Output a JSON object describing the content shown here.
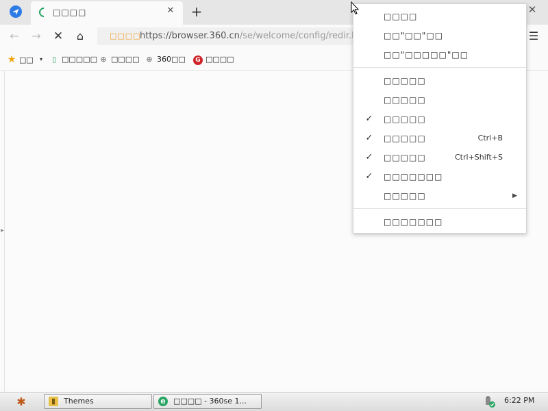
{
  "tabstrip": {
    "app_icon": "send-icon",
    "tab_title": "□□□□",
    "tab_close": "✕",
    "new_tab": "+",
    "window_close": "✕"
  },
  "toolbar": {
    "back": "←",
    "forward": "→",
    "stop": "✕",
    "home": "⌂",
    "address_tag": "□□□□",
    "url_host": "https://browser.360.cn",
    "url_path": "/se/welcome/config/redir.htm",
    "menu": "☰"
  },
  "bookmarks": [
    {
      "icon": "star-icon",
      "glyph": "★",
      "label": "□□"
    },
    {
      "icon": "phone-icon",
      "glyph": "▯",
      "label": "□□□□□"
    },
    {
      "icon": "globe-icon",
      "glyph": "⊕",
      "label": "□□□□"
    },
    {
      "icon": "globe-icon",
      "glyph": "⊕",
      "label": "360□□"
    },
    {
      "icon": "g-logo-icon",
      "glyph": "G",
      "label": "□□□□"
    }
  ],
  "bookmarks_dropdown": "▾",
  "context_menu": {
    "items": [
      {
        "label": "□□□□",
        "checked": false,
        "shortcut": "",
        "submenu": false
      },
      {
        "label": "□□\"□□\"□□",
        "checked": false,
        "shortcut": "",
        "submenu": false
      },
      {
        "label": "□□\"□□□□□\"□□",
        "checked": false,
        "shortcut": "",
        "submenu": false
      },
      {
        "label": "□□□□□",
        "checked": false,
        "shortcut": "",
        "submenu": false
      },
      {
        "label": "□□□□□",
        "checked": false,
        "shortcut": "",
        "submenu": false
      },
      {
        "label": "□□□□□",
        "checked": true,
        "shortcut": "",
        "submenu": false
      },
      {
        "label": "□□□□□",
        "checked": true,
        "shortcut": "Ctrl+B",
        "submenu": false
      },
      {
        "label": "□□□□□",
        "checked": true,
        "shortcut": "Ctrl+Shift+S",
        "submenu": false
      },
      {
        "label": "□□□□□□□",
        "checked": true,
        "shortcut": "",
        "submenu": false
      },
      {
        "label": "□□□□□",
        "checked": false,
        "shortcut": "",
        "submenu": true
      },
      {
        "label": "□□□□□□□",
        "checked": false,
        "shortcut": "",
        "submenu": false
      }
    ],
    "check_glyph": "✓",
    "submenu_glyph": "▶"
  },
  "taskbar": {
    "start_icon": "start-menu-icon",
    "tasks": [
      {
        "label": "Themes",
        "icon": "folder-icon"
      },
      {
        "label": "□□□□ - 360se 1...",
        "icon": "browser-360-icon"
      }
    ],
    "clock": "6:22 PM"
  }
}
